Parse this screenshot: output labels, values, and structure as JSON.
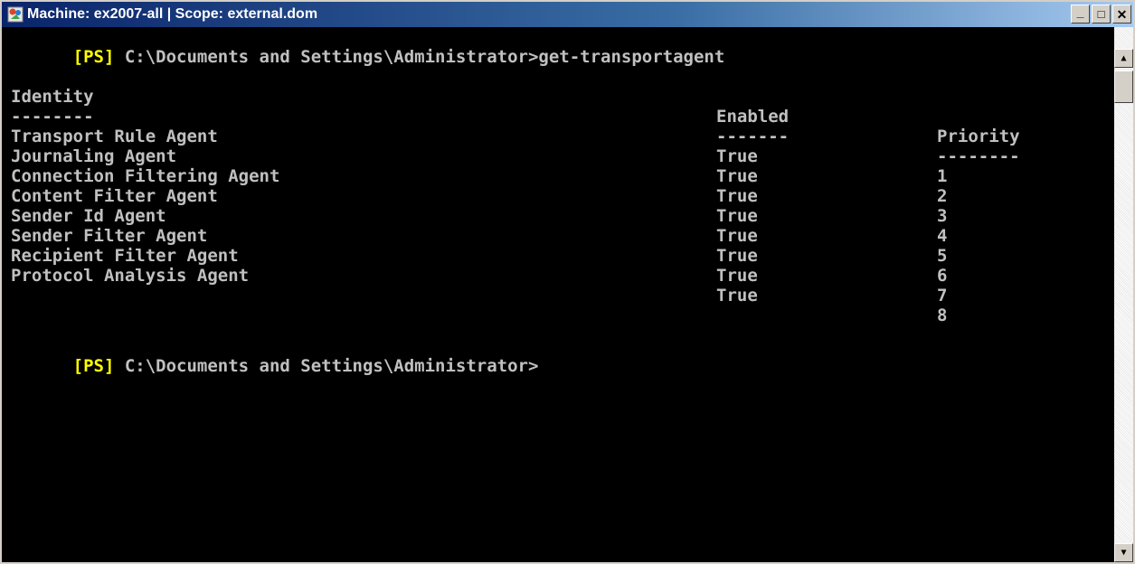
{
  "window": {
    "title": "Machine: ex2007-all | Scope: external.dom",
    "icon": "powershell-app-icon",
    "buttons": {
      "minimize": "_",
      "maximize": "□",
      "close": "✕"
    }
  },
  "console": {
    "prompt_tag": "[PS]",
    "prompt_path": " C:\\Documents and Settings\\Administrator>",
    "command": "get-transportagent",
    "headers": {
      "identity": "Identity",
      "enabled": "Enabled",
      "priority": "Priority"
    },
    "underlines": {
      "identity": "--------",
      "enabled": "-------",
      "priority": "--------"
    },
    "rows": [
      {
        "identity": "Transport Rule Agent",
        "enabled": "True",
        "priority": "1"
      },
      {
        "identity": "Journaling Agent",
        "enabled": "True",
        "priority": "2"
      },
      {
        "identity": "Connection Filtering Agent",
        "enabled": "True",
        "priority": "3"
      },
      {
        "identity": "Content Filter Agent",
        "enabled": "True",
        "priority": "4"
      },
      {
        "identity": "Sender Id Agent",
        "enabled": "True",
        "priority": "5"
      },
      {
        "identity": "Sender Filter Agent",
        "enabled": "True",
        "priority": "6"
      },
      {
        "identity": "Recipient Filter Agent",
        "enabled": "True",
        "priority": "7"
      },
      {
        "identity": "Protocol Analysis Agent",
        "enabled": "True",
        "priority": "8"
      }
    ]
  },
  "colors": {
    "background": "#000000",
    "text": "#c0c0c0",
    "prompt_tag": "#ffff00"
  },
  "scrollbar": {
    "up_icon": "scroll-up-arrow-icon",
    "down_icon": "scroll-down-arrow-icon",
    "up_glyph": "▲",
    "down_glyph": "▼"
  }
}
